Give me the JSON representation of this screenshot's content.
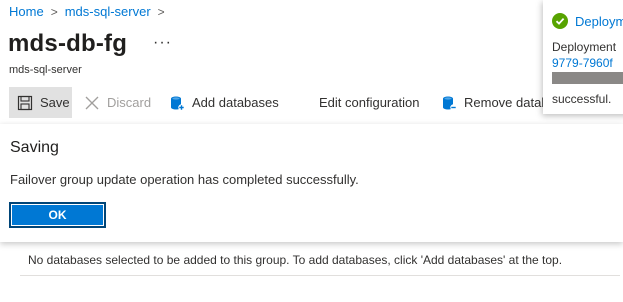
{
  "breadcrumb": [
    {
      "label": "Home"
    },
    {
      "label": "mds-sql-server"
    }
  ],
  "breadcrumb_separator": ">",
  "page": {
    "title": "mds-db-fg",
    "more_label": "···",
    "subtitle": "mds-sql-server"
  },
  "toolbar": {
    "save": "Save",
    "discard": "Discard",
    "add_databases": "Add databases",
    "edit_configuration": "Edit configuration",
    "remove_databases": "Remove datal"
  },
  "dialog": {
    "title": "Saving",
    "message": "Failover group update operation has completed successfully.",
    "ok": "OK"
  },
  "empty_note": "No databases selected to be added to this group. To add databases, click 'Add databases' at the top.",
  "notification": {
    "title": "Deploym",
    "line1": "Deployment",
    "link": "9779-7960f",
    "line2": "successful.",
    "status_color": "#57a300"
  },
  "colors": {
    "accent": "#0078d4",
    "success": "#57a300"
  }
}
